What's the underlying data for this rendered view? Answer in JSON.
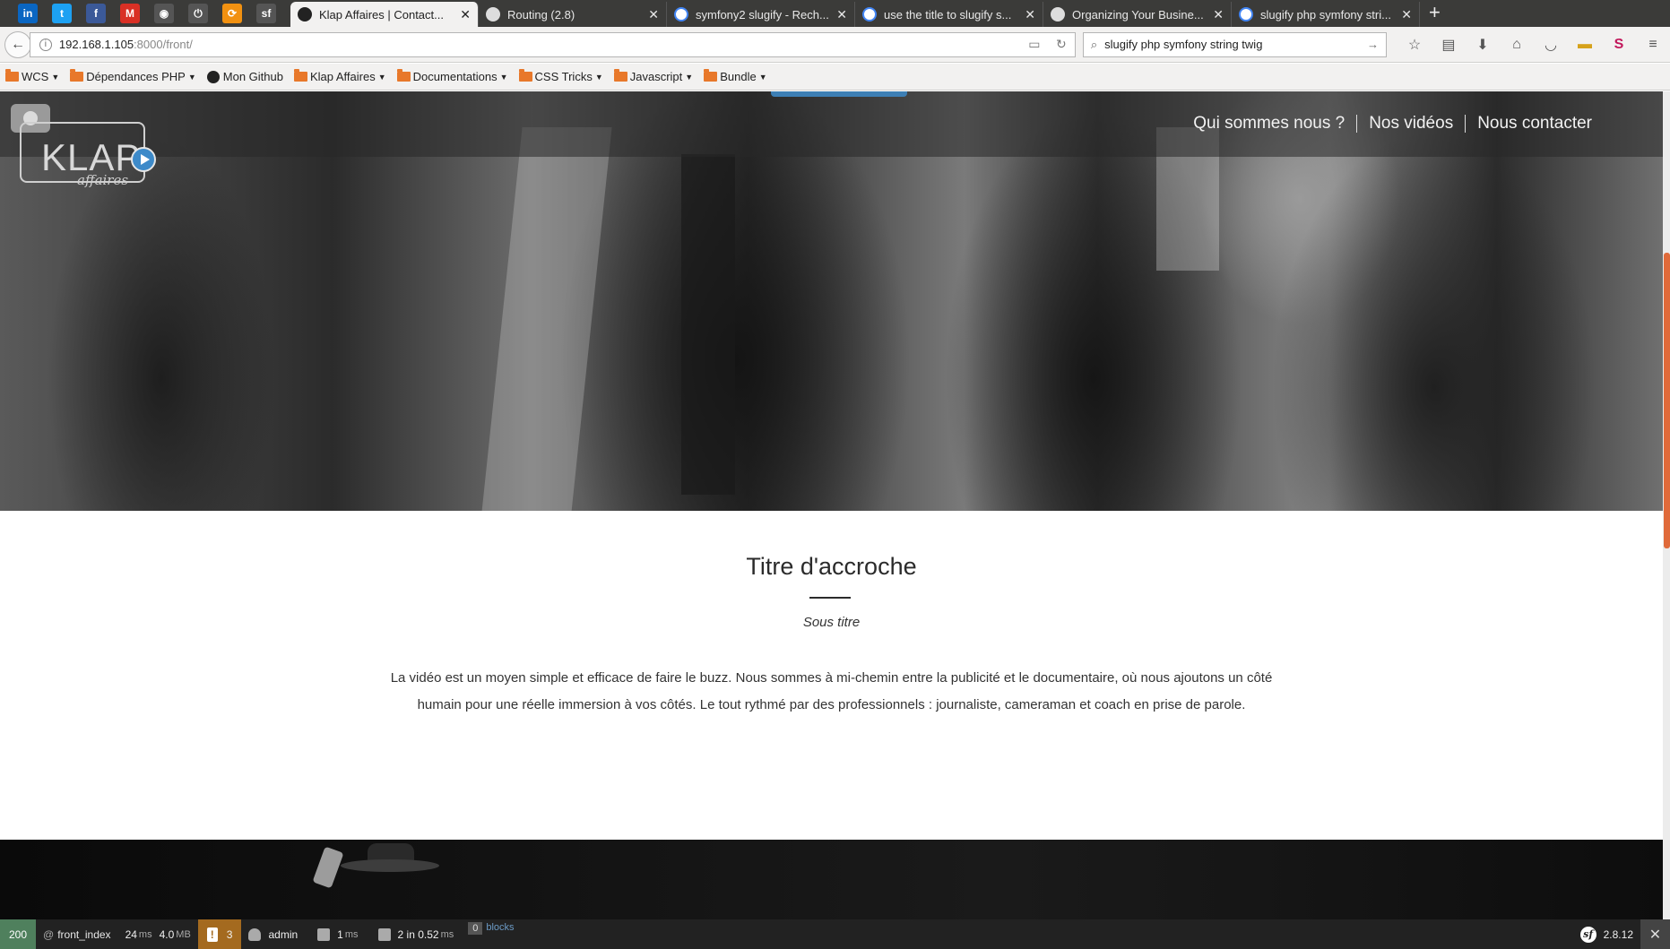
{
  "browser": {
    "pinned_tabs": [
      {
        "icon": "linkedin-icon",
        "glyph": "in",
        "color": "#0a66c2"
      },
      {
        "icon": "twitter-icon",
        "glyph": "t",
        "color": "#1da1f2"
      },
      {
        "icon": "facebook-icon",
        "glyph": "f",
        "color": "#3b5998"
      },
      {
        "icon": "gmail-icon",
        "glyph": "M",
        "color": "#d93025"
      },
      {
        "icon": "github-icon",
        "glyph": "◉",
        "color": "#555555"
      },
      {
        "icon": "power-icon",
        "glyph": "⏻",
        "color": "#555555"
      },
      {
        "icon": "sync-icon",
        "glyph": "⟳",
        "color": "#f29111"
      },
      {
        "icon": "symfony-icon",
        "glyph": "sf",
        "color": "#555555"
      }
    ],
    "tabs": [
      {
        "title": "Klap Affaires | Contact...",
        "icon": "symfony-icon",
        "active": true
      },
      {
        "title": "Routing (2.8)",
        "icon": "symfony-icon",
        "active": false
      },
      {
        "title": "symfony2 slugify - Rech...",
        "icon": "google-icon",
        "active": false
      },
      {
        "title": "use the title to slugify s...",
        "icon": "google-icon",
        "active": false
      },
      {
        "title": "Organizing Your Busine...",
        "icon": "symfony-icon",
        "active": false
      },
      {
        "title": "slugify php symfony stri...",
        "icon": "google-icon",
        "active": false
      }
    ],
    "new_tab_label": "+",
    "url_host": "192.168.1.105",
    "url_path": ":8000/front/",
    "search_query": "slugify php symfony string twig",
    "bookmarks": [
      {
        "label": "WCS",
        "type": "folder"
      },
      {
        "label": "Dépendances PHP",
        "type": "folder"
      },
      {
        "label": "Mon Github",
        "type": "link"
      },
      {
        "label": "Klap Affaires",
        "type": "folder"
      },
      {
        "label": "Documentations",
        "type": "folder"
      },
      {
        "label": "CSS Tricks",
        "type": "folder"
      },
      {
        "label": "Javascript",
        "type": "folder"
      },
      {
        "label": "Bundle",
        "type": "folder"
      }
    ]
  },
  "site": {
    "logo_word": "KLAP",
    "logo_sub": "affaires",
    "nav": [
      "Qui sommes nous ?",
      "Nos vidéos",
      "Nous contacter"
    ],
    "headline": "Titre d'accroche",
    "subtitle": "Sous titre",
    "body": "La vidéo est un moyen simple et efficace de faire le buzz. Nous sommes à mi-chemin entre la publicité et le documentaire, où nous ajoutons un côté humain pour une réelle immersion à vos côtés. Le tout rythmé par des professionnels : journaliste, cameraman et coach en prise de parole."
  },
  "toolbar": {
    "status": "200",
    "route": "front_index",
    "time_value": "24",
    "time_unit": "ms",
    "memory_value": "4.0",
    "memory_unit": "MB",
    "warnings": "3",
    "user": "admin",
    "form_value": "1",
    "form_unit": "ms",
    "db_value": "2 in 0.52",
    "db_unit": "ms",
    "blocks_count": "0",
    "blocks_label": "blocks",
    "version": "2.8.12"
  },
  "colors": {
    "status_ok": "#4f805d",
    "warning": "#a46a1f",
    "accent": "#3d8ac9",
    "scroll_thumb": "#e06a3a"
  }
}
